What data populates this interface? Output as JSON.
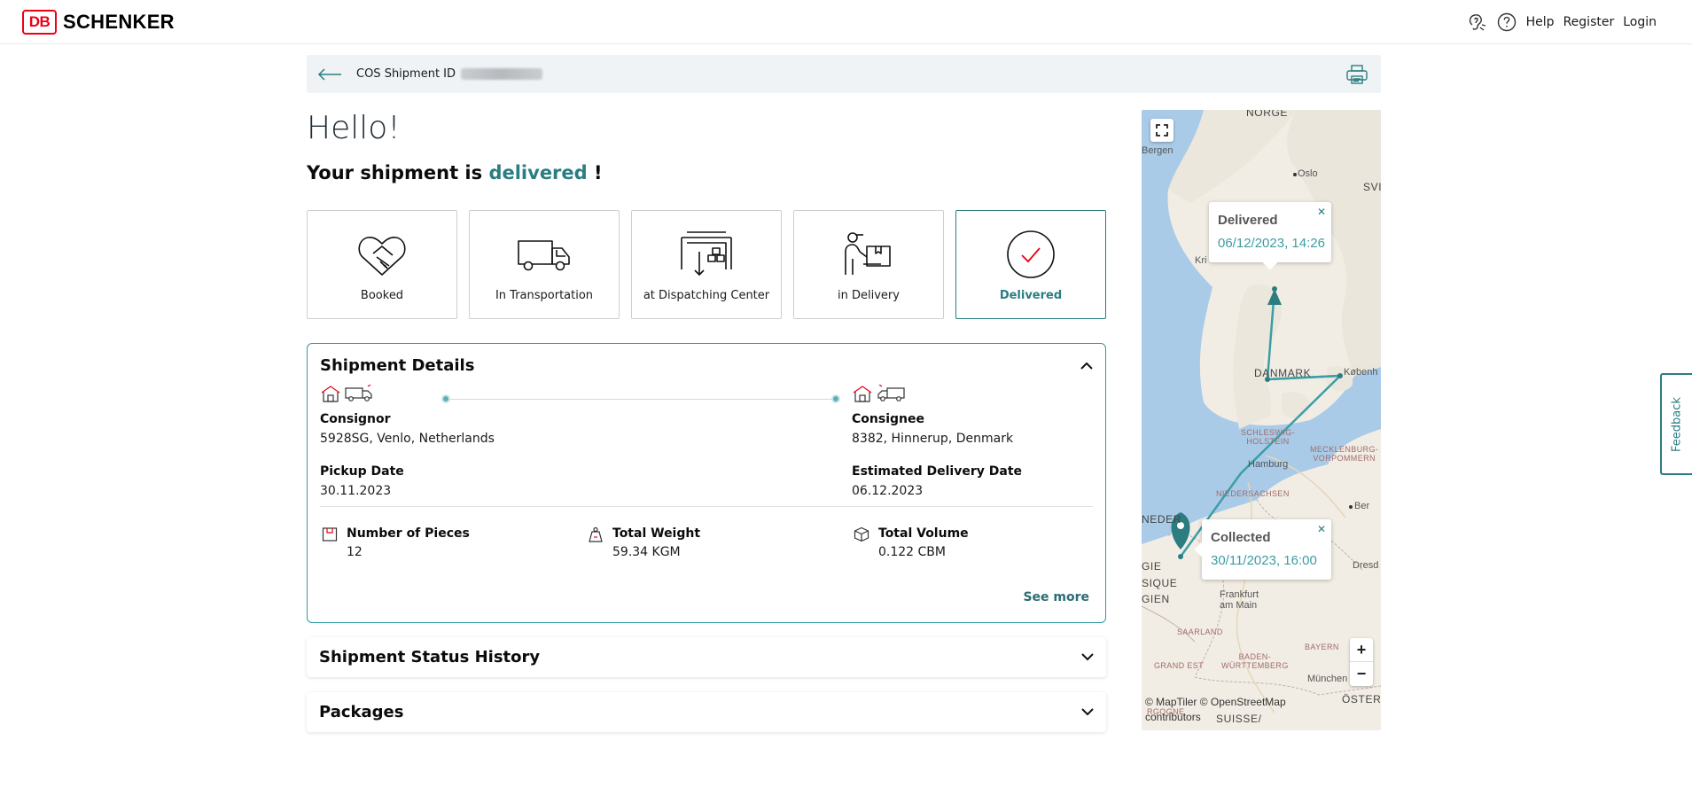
{
  "header": {
    "logo_mark": "DB",
    "logo_text": "SCHENKER",
    "nav": {
      "help": "Help",
      "register": "Register",
      "login": "Login"
    }
  },
  "idbar": {
    "label": "COS Shipment ID"
  },
  "greeting": "Hello!",
  "status": {
    "prefix": "Your shipment is",
    "state": "delivered",
    "suffix": "!"
  },
  "steps": [
    {
      "label": "Booked",
      "icon": "handshake-icon"
    },
    {
      "label": "In Transportation",
      "icon": "truck-icon"
    },
    {
      "label": "at Dispatching Center",
      "icon": "warehouse-icon"
    },
    {
      "label": "in Delivery",
      "icon": "courier-icon"
    },
    {
      "label": "Delivered",
      "icon": "check-circle-icon",
      "active": true
    }
  ],
  "details": {
    "title": "Shipment Details",
    "consignor": {
      "label": "Consignor",
      "value": "5928SG, Venlo, Netherlands"
    },
    "consignee": {
      "label": "Consignee",
      "value": "8382, Hinnerup, Denmark"
    },
    "pickup": {
      "label": "Pickup Date",
      "value": "30.11.2023"
    },
    "delivery": {
      "label": "Estimated Delivery Date",
      "value": "06.12.2023"
    },
    "pieces": {
      "label": "Number of Pieces",
      "value": "12"
    },
    "weight": {
      "label": "Total Weight",
      "value": "59.34 KGM"
    },
    "volume": {
      "label": "Total Volume",
      "value": "0.122 CBM"
    },
    "see_more": "See more"
  },
  "sections": {
    "history": "Shipment Status History",
    "packages": "Packages"
  },
  "map": {
    "labels": {
      "norge": "NORGE",
      "bergen": "Bergen",
      "oslo": "Oslo",
      "svi": "SVI",
      "kri": "Kri",
      "danmark": "DANMARK",
      "kobenh": "Københ",
      "schleswig": "SCHLESWIG-\nHOLSTEIN",
      "mecklenburg": "MECKLENBURG-\nVORPOMMERN",
      "hamburg": "Hamburg",
      "niedersachsen": "NIEDERSACHSEN",
      "ber": "Ber",
      "neder": "NEDER",
      "gie": "GIE",
      "sique": "SIQUE",
      "gien": "GIEN",
      "dresd": "Dresd",
      "frankfurt": "Frankfurt\nam Main",
      "saarland": "SAARLAND",
      "bayern": "BAYERN",
      "baden": "BADEN-\nWÜRTTEMBERG",
      "grand_est": "GRAND EST",
      "munchen": "München",
      "suisse": "SUISSE/",
      "oster": "ÖSTER",
      "bourgogne": "RGOGNE"
    },
    "popup_delivered": {
      "title": "Delivered",
      "datetime": "06/12/2023, 14:26"
    },
    "popup_collected": {
      "title": "Collected",
      "datetime": "30/11/2023, 16:00"
    },
    "zoom_in": "+",
    "zoom_out": "−",
    "attribution_line1": "© MapTiler © OpenStreetMap",
    "attribution_line2": "contributors"
  },
  "feedback": "Feedback",
  "colors": {
    "accent": "#2b7d82",
    "brand_red": "#ec0016",
    "route": "#3a9fa4"
  }
}
